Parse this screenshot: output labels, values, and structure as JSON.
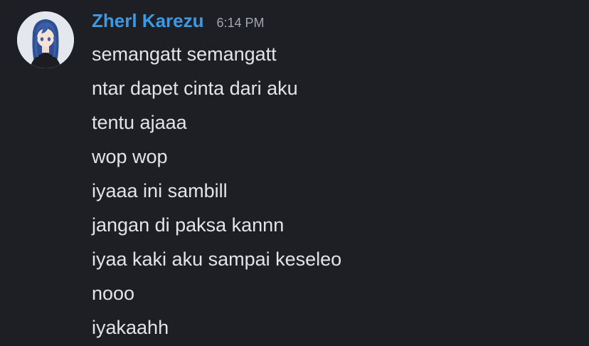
{
  "message_group": {
    "author": {
      "name": "Zherl Karezu",
      "name_color": "#3b9ae6",
      "avatar": "anime-character-avatar"
    },
    "timestamp": "6:14 PM",
    "messages": [
      "semangatt semangatt",
      "ntar dapet cinta dari aku",
      "tentu ajaaa",
      "wop wop",
      "iyaaa ini sambill",
      "jangan di paksa kannn",
      "iyaa kaki aku sampai keseleo",
      "nooo",
      "iyakaahh"
    ]
  },
  "theme": {
    "background": "#1e1f24",
    "text": "#e3e4e8",
    "muted": "#a3a6ae"
  }
}
